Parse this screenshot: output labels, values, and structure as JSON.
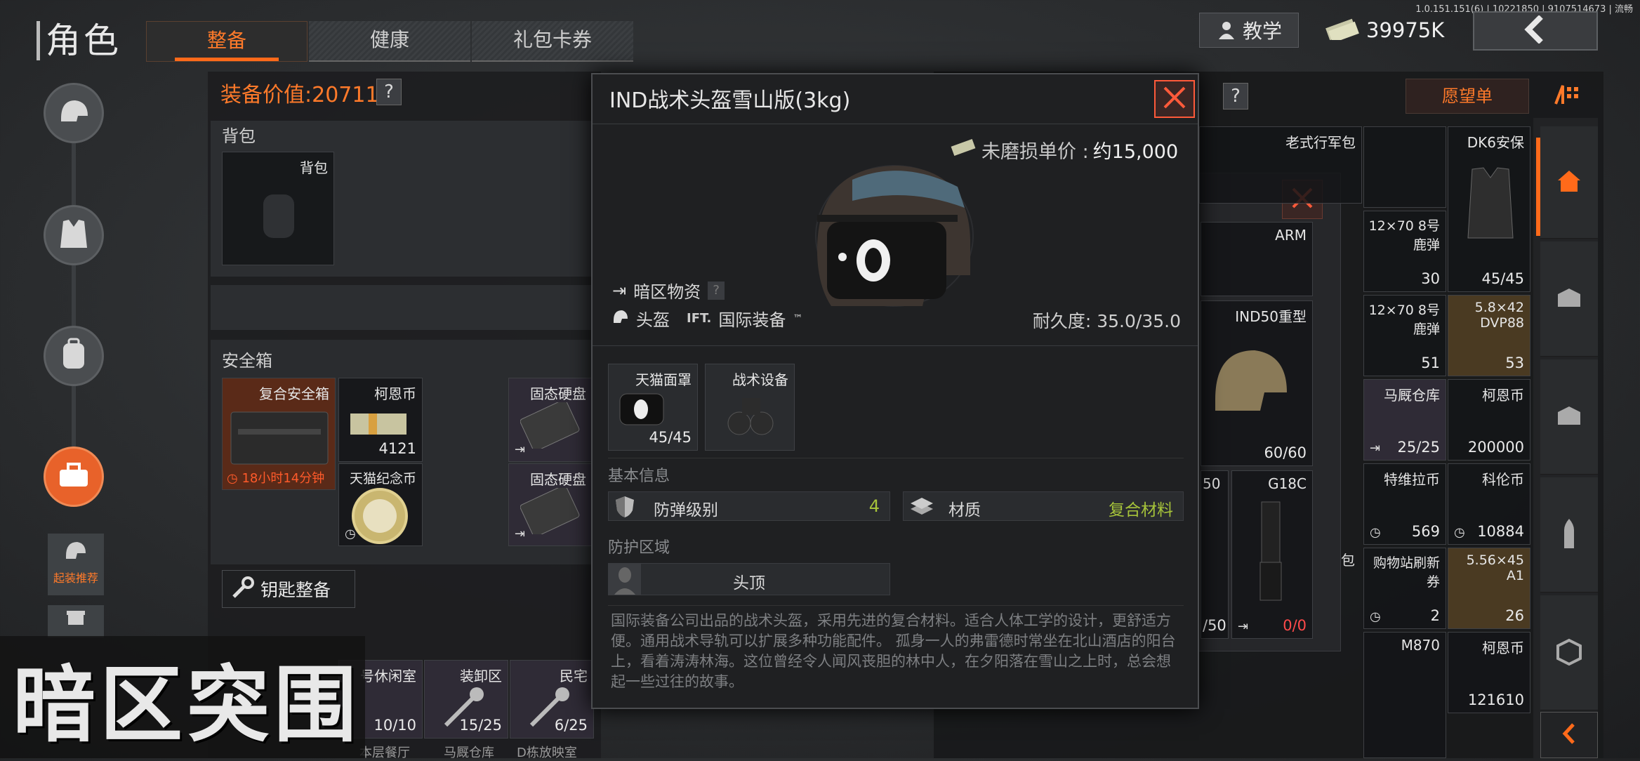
{
  "version_text": "1.0.151.151(6) | 10221850 | 9107514673 | 流畅",
  "header": {
    "title": "角色",
    "tabs": [
      {
        "label": "整备"
      },
      {
        "label": "健康"
      },
      {
        "label": "礼包卡券"
      }
    ],
    "tutorial_label": "教学",
    "currency": "39975K",
    "back_icon": "chevron-left-icon"
  },
  "left_nav": {
    "icons": [
      "helmet-icon",
      "vest-icon",
      "backpack-icon",
      "toolbox-icon"
    ],
    "recommend_label": "起装推荐"
  },
  "loadout": {
    "value_label": "装备价值:",
    "value": "20711",
    "help": "?",
    "backpack_section": "背包",
    "backpack_slot": "背包",
    "safe_section": "安全箱",
    "safe_box_name": "复合安全箱",
    "safe_box_timer": "18小时14分钟",
    "safe_items": [
      {
        "name": "柯恩币",
        "count": "4121"
      },
      {
        "name": "固态硬盘",
        "count": ""
      },
      {
        "name": "天猫纪念币",
        "count": ""
      },
      {
        "name": "固态硬盘",
        "count": ""
      }
    ],
    "key_button": "钥匙整备",
    "key_items": [
      {
        "name": "号休闲室",
        "count": "10/10"
      },
      {
        "name": "装卸区",
        "count": "15/25"
      },
      {
        "name": "民宅",
        "count": "6/25"
      }
    ],
    "key_items_row2": [
      "本层餐厅",
      "马厩仓库",
      "D栋放映室"
    ]
  },
  "right_panel": {
    "wishlist": "愿望单",
    "help": "?",
    "slots": [
      {
        "name": "老式行军包",
        "count": ""
      },
      {
        "name": "DK6安保",
        "count": "45/45"
      },
      {
        "name": "12×70 8号鹿弹",
        "count": "30"
      },
      {
        "name": "12×70 8号鹿弹",
        "count": "51"
      },
      {
        "name": "5.8×42 DVP88",
        "count": "53"
      },
      {
        "name": "马厩仓库",
        "count": "25/25"
      },
      {
        "name": "柯恩币",
        "count": "200000"
      },
      {
        "name": "特维拉币",
        "count": "569"
      },
      {
        "name": "科伦币",
        "count": "10884"
      },
      {
        "name": "购物站刷新券",
        "count": "2"
      },
      {
        "name": "5.56×45 A1",
        "count": "26"
      },
      {
        "name": "M870",
        "count": ""
      },
      {
        "name": "柯恩币",
        "count": "121610"
      }
    ],
    "behind": {
      "arm": "ARM",
      "ind50": "IND50重型",
      "ind50_count": "60/60",
      "g18c": "G18C",
      "g18c_count": "0/0",
      "partial_50": "50",
      "partial_count": "/50",
      "partial_bag": "包"
    }
  },
  "modal": {
    "title": "IND战术头盔雪山版(3kg)",
    "price_label": "未磨损单价 :",
    "price_value": "约15,000",
    "category": "暗区物资",
    "type": "头盔",
    "brand": "国际装备",
    "brand_tm": "™",
    "durability_label": "耐久度:",
    "durability_value": "35.0/35.0",
    "attachments": [
      {
        "name": "天猫面罩",
        "count": "45/45"
      },
      {
        "name": "战术设备",
        "count": ""
      }
    ],
    "basic_info_label": "基本信息",
    "armor_level_label": "防弹级别",
    "armor_level": "4",
    "material_label": "材质",
    "material_value": "复合材料",
    "protect_label": "防护区域",
    "protect_value": "头顶",
    "description": "国际装备公司出品的战术头盔，采用先进的复合材料。适合人体工学的设计，更舒适方便。通用战术导轨可以扩展多种功能配件。 孤身一人的弗雷德时常坐在北山酒店的阳台上，看着涛涛林海。这位曾经令人闻风丧胆的林中人，在夕阳落在雪山之上时，总会想起一些过往的故事。"
  },
  "logo_text": "暗区突围",
  "colors": {
    "accent": "#ff6a1a",
    "green": "#a6c33a",
    "modal_bg": "#1f2022"
  }
}
